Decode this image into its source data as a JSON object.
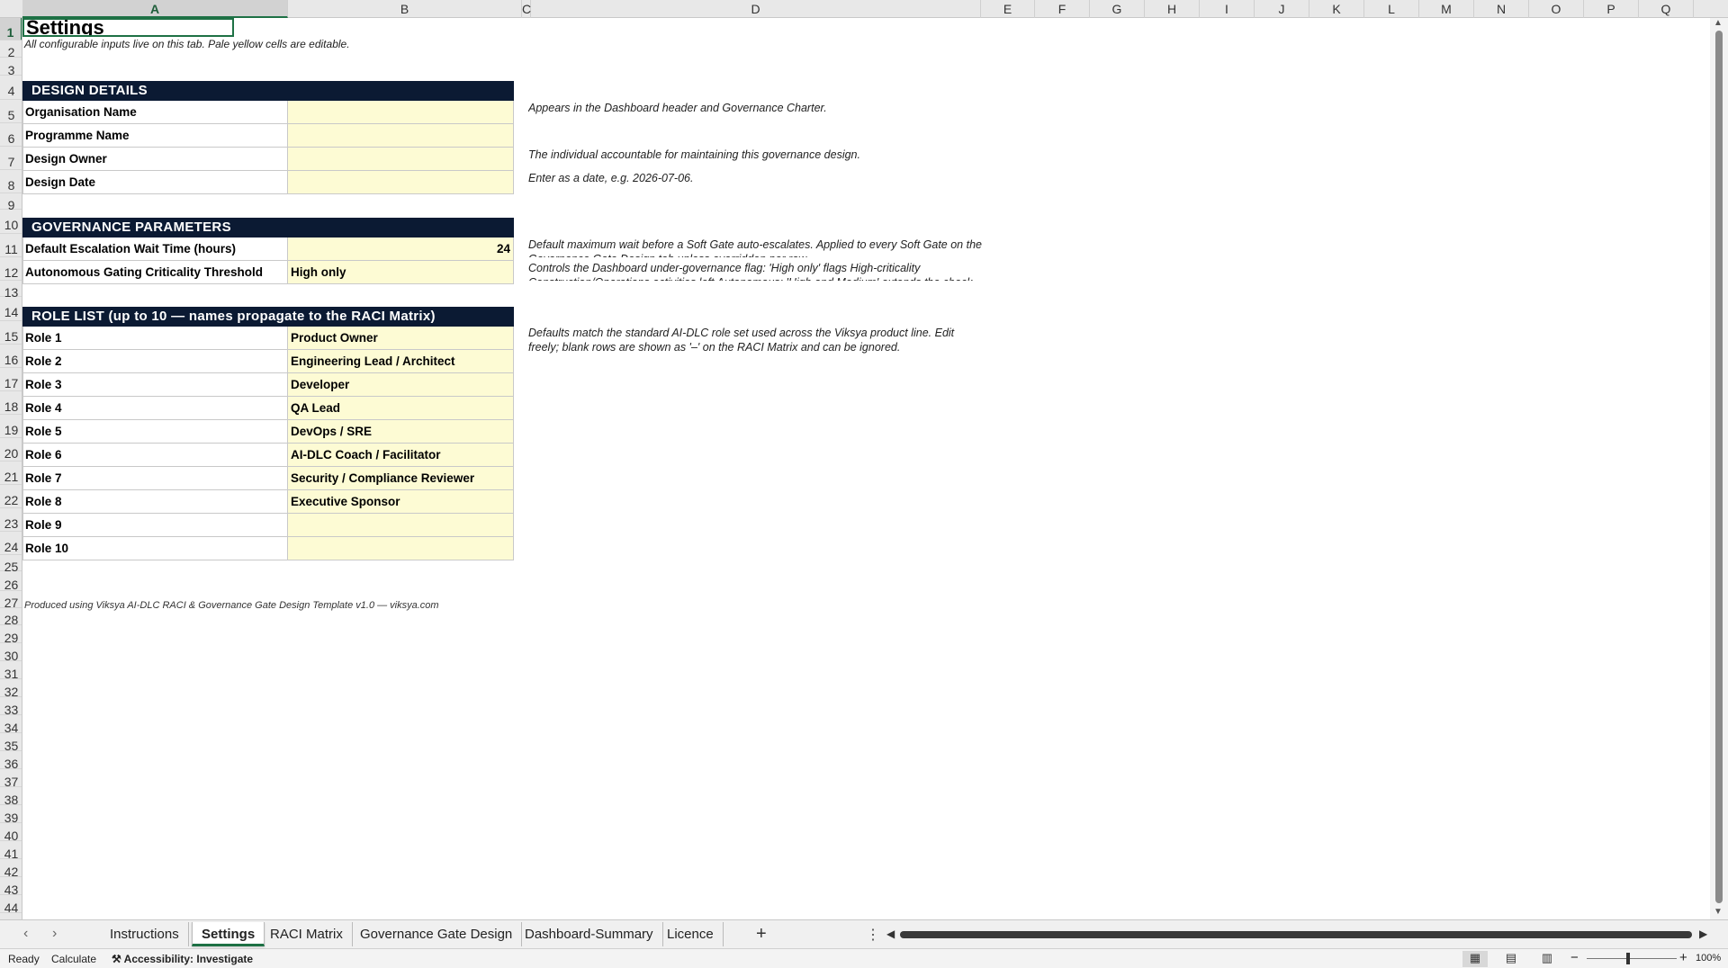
{
  "columns": [
    "A",
    "B",
    "C",
    "D",
    "E",
    "F",
    "G",
    "H",
    "I",
    "J",
    "K",
    "L",
    "M",
    "N",
    "O",
    "P",
    "Q"
  ],
  "rows": [
    "1",
    "2",
    "3",
    "4",
    "5",
    "6",
    "7",
    "8",
    "9",
    "10",
    "11",
    "12",
    "13",
    "14",
    "15",
    "16",
    "17",
    "18",
    "19",
    "20",
    "21",
    "22",
    "23",
    "24",
    "25",
    "26",
    "27",
    "28",
    "29",
    "30",
    "31",
    "32",
    "33",
    "34",
    "35",
    "36",
    "37",
    "38",
    "39",
    "40",
    "41",
    "42",
    "43",
    "44"
  ],
  "sheet": {
    "title": "Settings",
    "subtitle": "All configurable inputs live on this tab. Pale yellow cells are editable.",
    "design_details": {
      "header": "DESIGN DETAILS",
      "fields": [
        {
          "label": "Organisation Name",
          "value": ""
        },
        {
          "label": "Programme Name",
          "value": ""
        },
        {
          "label": "Design Owner",
          "value": ""
        },
        {
          "label": "Design Date",
          "value": ""
        }
      ],
      "notes": {
        "org": "Appears in the Dashboard header and Governance Charter.",
        "owner": "The individual accountable for maintaining this governance design.",
        "date": "Enter as a date, e.g. 2026-07-06."
      }
    },
    "governance": {
      "header": "GOVERNANCE PARAMETERS",
      "fields": [
        {
          "label": "Default Escalation Wait Time (hours)",
          "value": "24"
        },
        {
          "label": "Autonomous Gating Criticality Threshold",
          "value": "High only"
        }
      ],
      "notes": {
        "wait": "Default maximum wait before a Soft Gate auto-escalates. Applied to every Soft Gate on the Governance Gate Design tab unless overridden per row.",
        "threshold": "Controls the Dashboard under-governance flag: 'High only' flags High-criticality Construction/Operations activities left Autonomous; 'High and Medium' extends the check"
      }
    },
    "roles": {
      "header": "ROLE LIST (up to 10 — names propagate to the RACI Matrix)",
      "items": [
        {
          "label": "Role 1",
          "value": "Product Owner"
        },
        {
          "label": "Role 2",
          "value": "Engineering Lead / Architect"
        },
        {
          "label": "Role 3",
          "value": "Developer"
        },
        {
          "label": "Role 4",
          "value": "QA Lead"
        },
        {
          "label": "Role 5",
          "value": "DevOps / SRE"
        },
        {
          "label": "Role 6",
          "value": "AI-DLC Coach / Facilitator"
        },
        {
          "label": "Role 7",
          "value": "Security / Compliance Reviewer"
        },
        {
          "label": "Role 8",
          "value": "Executive Sponsor"
        },
        {
          "label": "Role 9",
          "value": ""
        },
        {
          "label": "Role 10",
          "value": ""
        }
      ],
      "note": "Defaults match the standard AI-DLC role set used across the Viksya product line. Edit freely; blank rows are shown as '–' on the RACI Matrix and can be ignored."
    },
    "footer": "Produced using Viksya AI-DLC RACI & Governance Gate Design Template v1.0 — viksya.com"
  },
  "tabs": [
    {
      "label": "Instructions",
      "active": false
    },
    {
      "label": "Settings",
      "active": true
    },
    {
      "label": "RACI Matrix",
      "active": false
    },
    {
      "label": "Governance Gate Design",
      "active": false
    },
    {
      "label": "Dashboard-Summary",
      "active": false
    },
    {
      "label": "Licence",
      "active": false
    }
  ],
  "status": {
    "ready": "Ready",
    "calculate": "Calculate",
    "accessibility": "Accessibility: Investigate",
    "zoom": "100%"
  },
  "icons": {
    "prev_sheet": "chevron-left-icon",
    "next_sheet": "chevron-right-icon",
    "add_sheet": "plus-icon",
    "more": "more-vertical-icon",
    "accessibility": "accessibility-icon"
  },
  "colors": {
    "band": "#0b1a33",
    "input": "#fdfbd4",
    "accent": "#1e7145"
  }
}
